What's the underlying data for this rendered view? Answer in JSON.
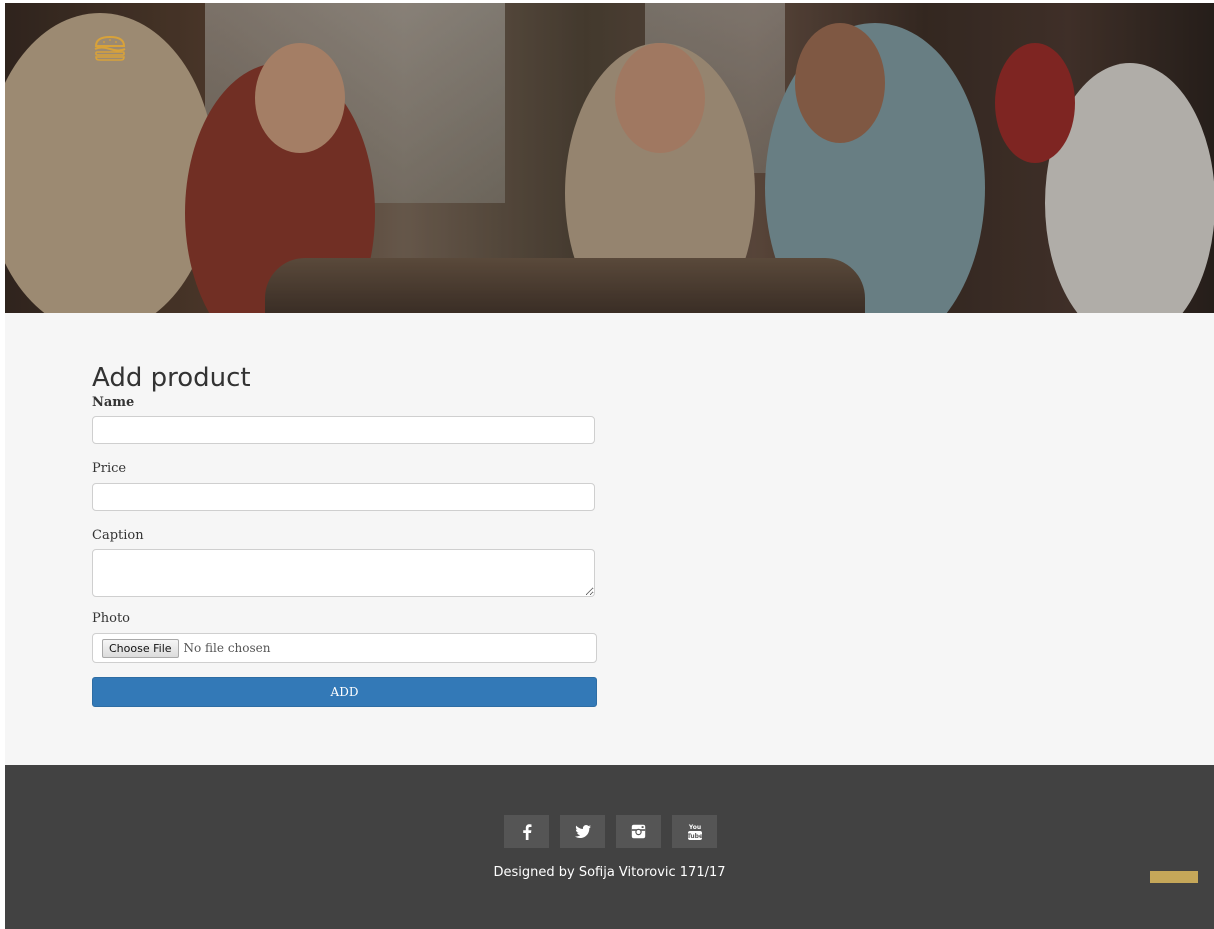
{
  "header": {
    "logo_icon": "burger-icon"
  },
  "form": {
    "title": "Add product",
    "name_label": "Name",
    "price_label": "Price",
    "caption_label": "Caption",
    "photo_label": "Photo",
    "file_button": "Choose File",
    "file_status": "No file chosen",
    "submit_label": "ADD"
  },
  "footer": {
    "social": [
      {
        "icon": "facebook-icon"
      },
      {
        "icon": "twitter-icon"
      },
      {
        "icon": "instagram-icon"
      },
      {
        "icon": "youtube-icon"
      }
    ],
    "credit": "Designed by Sofija Vitorovic 171/17"
  },
  "colors": {
    "accent": "#c5a759",
    "primary_button": "#3379b7",
    "footer_bg": "#424242",
    "main_bg": "#f6f6f6"
  }
}
